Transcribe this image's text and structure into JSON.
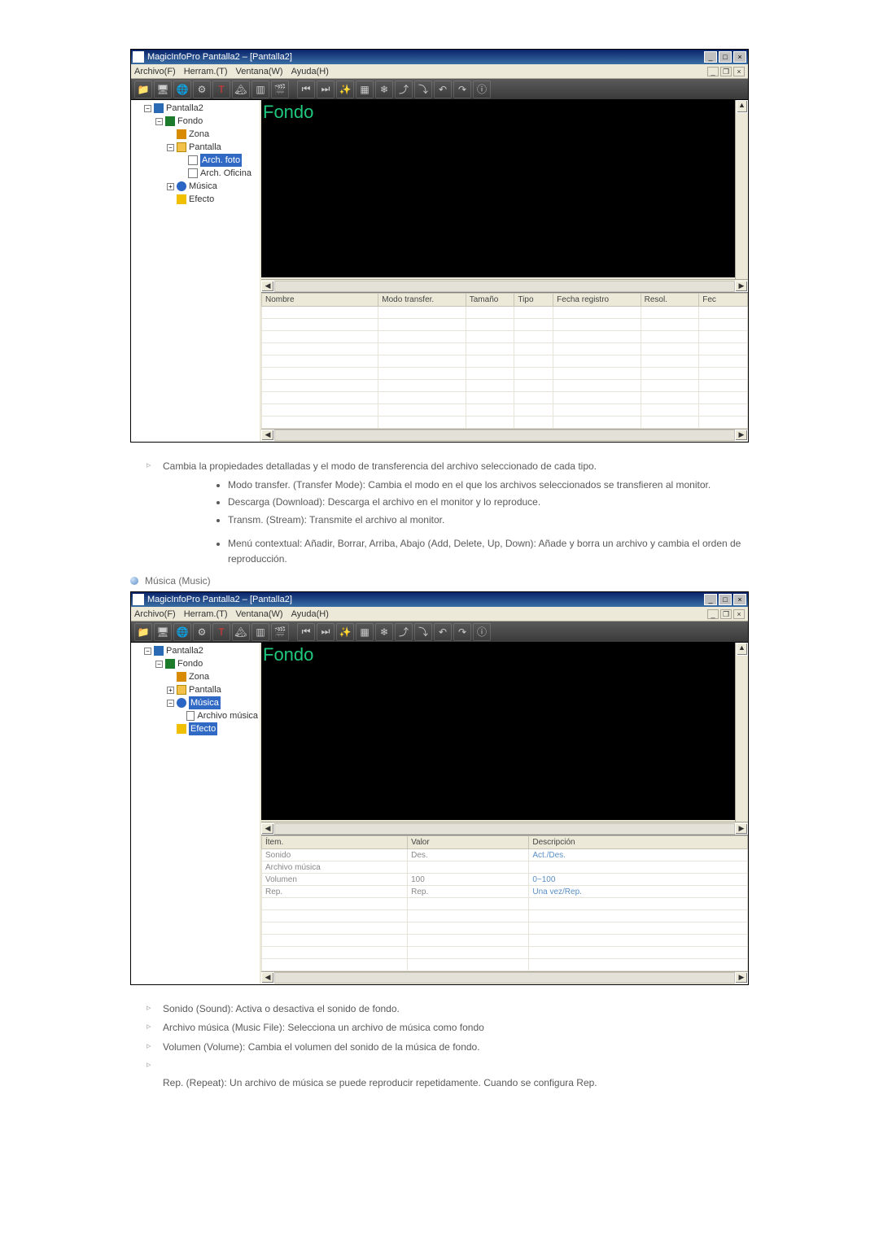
{
  "app": {
    "title": "MagicInfoPro Pantalla2 – [Pantalla2]",
    "win_buttons": {
      "min": "_",
      "max": "□",
      "close": "×"
    },
    "menu": {
      "file": "Archivo(F)",
      "tools": "Herram.(T)",
      "window": "Ventana(W)",
      "help": "Ayuda(H)"
    },
    "mdi": {
      "min": "_",
      "restore": "❐",
      "close": "×"
    }
  },
  "toolbar_icons": [
    "folder-icon",
    "screen-icon",
    "globe-icon",
    "config-icon",
    "text-icon",
    "mountain-icon",
    "page-icon",
    "clapper-icon",
    "rewind-icon",
    "end-icon",
    "wand-icon",
    "calendar-icon",
    "snowflake-icon",
    "up-arrow-icon",
    "down-arrow-icon",
    "undo-icon",
    "redo-icon",
    "info-icon"
  ],
  "canvas_label": "Fondo",
  "tree1": {
    "root": "Pantalla2",
    "fondo": "Fondo",
    "zona": "Zona",
    "pantalla": "Pantalla",
    "arch_foto": "Arch. foto",
    "arch_oficina": "Arch. Oficina",
    "musica": "Música",
    "efecto": "Efecto"
  },
  "grid1": {
    "headers": [
      "Nombre",
      "Modo transfer.",
      "Tamaño",
      "Tipo",
      "Fecha registro",
      "Resol.",
      "Fec"
    ]
  },
  "doc1": {
    "intro": "Cambia la propiedades detalladas y el modo de transferencia del archivo seleccionado de cada tipo.",
    "b1": "Modo transfer. (Transfer Mode): Cambia el modo en el que los archivos seleccionados se transfieren al monitor.",
    "b2": "Descarga (Download): Descarga el archivo en el monitor y lo reproduce.",
    "b3": "Transm. (Stream): Transmite el archivo al monitor.",
    "b4": "Menú contextual: Añadir, Borrar, Arriba, Abajo (Add, Delete, Up, Down): Añade y borra un archivo y cambia el orden de reproducción."
  },
  "section2_title": "Música (Music)",
  "tree2": {
    "root": "Pantalla2",
    "fondo": "Fondo",
    "zona": "Zona",
    "pantalla": "Pantalla",
    "musica": "Música",
    "archivo_musica": "Archivo música",
    "efecto": "Efecto"
  },
  "grid2": {
    "headers": [
      "Ítem.",
      "Valor",
      "Descripción"
    ],
    "rows": [
      {
        "item": "Sonido",
        "valor": "Des.",
        "desc": "Act./Des."
      },
      {
        "item": "Archivo música",
        "valor": "",
        "desc": ""
      },
      {
        "item": "Volumen",
        "valor": "100",
        "desc": "0~100"
      },
      {
        "item": "Rep.",
        "valor": "Rep.",
        "desc": "Una vez/Rep."
      }
    ]
  },
  "doc2": {
    "l1": "Sonido (Sound): Activa o desactiva el sonido de fondo.",
    "l2": "Archivo música (Music File): Selecciona un archivo de música como fondo",
    "l3": "Volumen (Volume): Cambia el volumen del sonido de la música de fondo.",
    "l4": "Rep. (Repeat): Un archivo de música se puede reproducir repetidamente. Cuando se configura Rep."
  }
}
